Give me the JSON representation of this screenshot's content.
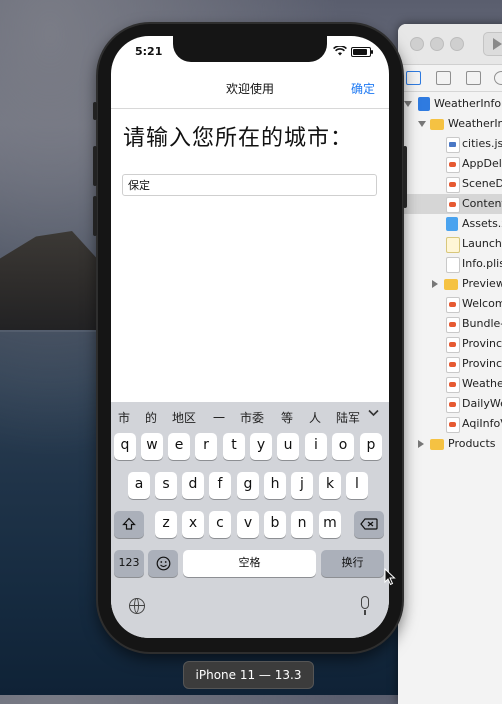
{
  "status_bar": {
    "time": "5:21"
  },
  "nav": {
    "title": "欢迎使用",
    "confirm_label": "确定"
  },
  "content": {
    "prompt": "请输入您所在的城市：",
    "city_value": "保定"
  },
  "keyboard": {
    "candidates": [
      "市",
      "的",
      "地区",
      "一",
      "市委",
      "等",
      "人",
      "陆军"
    ],
    "row1": [
      "q",
      "w",
      "e",
      "r",
      "t",
      "y",
      "u",
      "i",
      "o",
      "p"
    ],
    "row2": [
      "a",
      "s",
      "d",
      "f",
      "g",
      "h",
      "j",
      "k",
      "l"
    ],
    "row3": [
      "z",
      "x",
      "c",
      "v",
      "b",
      "n",
      "m"
    ],
    "num_label": "123",
    "space_label": "空格",
    "return_label": "换行"
  },
  "simulator": {
    "device_label": "iPhone 11 — 13.3"
  },
  "xcode": {
    "tree": [
      {
        "label": "WeatherInfo",
        "icon": "project-icon"
      },
      {
        "label": "WeatherInfo",
        "icon": "folder-icon"
      },
      {
        "label": "cities.json",
        "icon": "json-file-icon"
      },
      {
        "label": "AppDelegate.swift",
        "icon": "swift-file-icon"
      },
      {
        "label": "SceneDelegate.swift",
        "icon": "swift-file-icon"
      },
      {
        "label": "ContentView.swift",
        "icon": "swift-file-icon"
      },
      {
        "label": "Assets.xcassets",
        "icon": "assets-icon"
      },
      {
        "label": "LaunchScreen.storyboard",
        "icon": "storyboard-icon"
      },
      {
        "label": "Info.plist",
        "icon": "plist-icon"
      },
      {
        "label": "Preview Content",
        "icon": "folder-icon"
      },
      {
        "label": "WelcomeView.swift",
        "icon": "swift-file-icon"
      },
      {
        "label": "Bundle-Extension.swift",
        "icon": "swift-file-icon"
      },
      {
        "label": "ProvinceView.swift",
        "icon": "swift-file-icon"
      },
      {
        "label": "ProvinceListView.swift",
        "icon": "swift-file-icon"
      },
      {
        "label": "WeatherView.swift",
        "icon": "swift-file-icon"
      },
      {
        "label": "DailyWeatherView.swift",
        "icon": "swift-file-icon"
      },
      {
        "label": "AqiInfoView.swift",
        "icon": "swift-file-icon"
      },
      {
        "label": "Products",
        "icon": "folder-icon"
      }
    ]
  }
}
